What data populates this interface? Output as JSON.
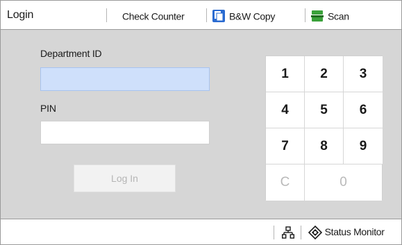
{
  "header": {
    "title": "Login",
    "items": [
      {
        "label": "Check Counter",
        "icon": "none"
      },
      {
        "label": "B&W Copy",
        "icon": "copy-icon"
      },
      {
        "label": "Scan",
        "icon": "scan-icon"
      }
    ]
  },
  "form": {
    "department_label": "Department ID",
    "department_value": "",
    "pin_label": "PIN",
    "pin_value": "",
    "login_label": "Log In"
  },
  "keypad": {
    "keys": [
      "1",
      "2",
      "3",
      "4",
      "5",
      "6",
      "7",
      "8",
      "9",
      "C",
      "0"
    ]
  },
  "footer": {
    "status_monitor_label": "Status Monitor",
    "network_icon": "network-icon",
    "status_icon": "status-monitor-icon"
  },
  "colors": {
    "active_field": "#cfe0fb",
    "copy_icon_blue": "#2a6bd1",
    "scan_icon_green": "#3aa13a"
  }
}
